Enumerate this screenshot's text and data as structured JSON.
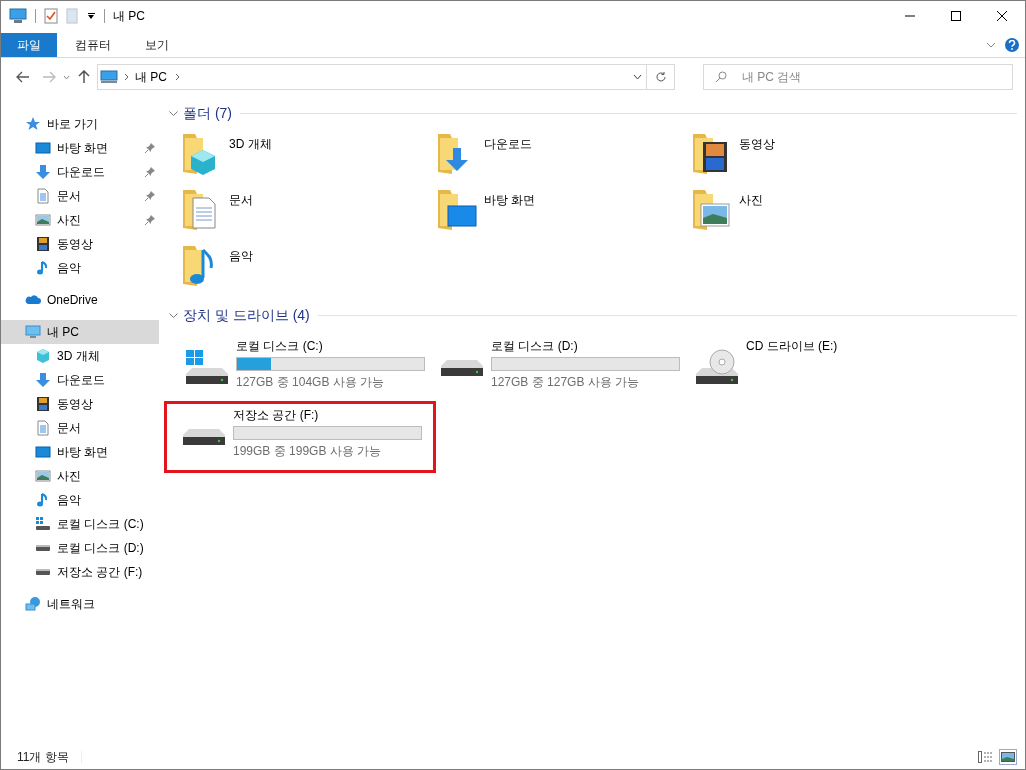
{
  "window": {
    "title": "내 PC"
  },
  "ribbon_tabs": [
    {
      "label": "파일",
      "selected": true
    },
    {
      "label": "컴퓨터",
      "selected": false
    },
    {
      "label": "보기",
      "selected": false
    }
  ],
  "address_bar": {
    "location": "내 PC"
  },
  "search": {
    "placeholder": "내 PC 검색"
  },
  "sidebar": {
    "items": [
      {
        "label": "바로 가기",
        "kind": "star",
        "selected": false,
        "children": [
          {
            "label": "바탕 화면",
            "kind": "desktop",
            "pinned": true,
            "selected": false
          },
          {
            "label": "다운로드",
            "kind": "downloads",
            "pinned": true,
            "selected": false
          },
          {
            "label": "문서",
            "kind": "documents",
            "pinned": true,
            "selected": false
          },
          {
            "label": "사진",
            "kind": "pictures",
            "pinned": true,
            "selected": false
          },
          {
            "label": "동영상",
            "kind": "videos",
            "pinned": false,
            "selected": false
          },
          {
            "label": "음악",
            "kind": "music",
            "pinned": false,
            "selected": false
          }
        ]
      },
      {
        "label": "OneDrive",
        "kind": "cloud",
        "selected": false
      },
      {
        "label": "내 PC",
        "kind": "pc",
        "selected": true,
        "children": [
          {
            "label": "3D 개체",
            "kind": "cube",
            "pinned": false,
            "selected": false
          },
          {
            "label": "다운로드",
            "kind": "downloads",
            "pinned": false,
            "selected": false
          },
          {
            "label": "동영상",
            "kind": "videos",
            "pinned": false,
            "selected": false
          },
          {
            "label": "문서",
            "kind": "documents",
            "pinned": false,
            "selected": false
          },
          {
            "label": "바탕 화면",
            "kind": "desktop",
            "pinned": false,
            "selected": false
          },
          {
            "label": "사진",
            "kind": "pictures",
            "pinned": false,
            "selected": false
          },
          {
            "label": "음악",
            "kind": "music",
            "pinned": false,
            "selected": false
          },
          {
            "label": "로컬 디스크 (C:)",
            "kind": "windrive",
            "pinned": false,
            "selected": false
          },
          {
            "label": "로컬 디스크 (D:)",
            "kind": "drive",
            "pinned": false,
            "selected": false
          },
          {
            "label": "저장소 공간 (F:)",
            "kind": "drive",
            "pinned": false,
            "selected": false
          }
        ]
      },
      {
        "label": "네트워크",
        "kind": "network",
        "selected": false
      }
    ]
  },
  "folders": {
    "heading": "폴더 (7)",
    "expanded": true,
    "items": [
      {
        "label": "3D 개체",
        "kind": "cube"
      },
      {
        "label": "다운로드",
        "kind": "downloads"
      },
      {
        "label": "동영상",
        "kind": "videos"
      },
      {
        "label": "문서",
        "kind": "documents"
      },
      {
        "label": "바탕 화면",
        "kind": "desktop"
      },
      {
        "label": "사진",
        "kind": "pictures"
      },
      {
        "label": "음악",
        "kind": "music"
      }
    ]
  },
  "drives": {
    "heading": "장치 및 드라이브 (4)",
    "expanded": true,
    "items": [
      {
        "label": "로컬 디스크 (C:)",
        "kind": "windrive",
        "level": 0.18,
        "free": "127GB 중 104GB 사용 가능",
        "highlighted": false
      },
      {
        "label": "로컬 디스크 (D:)",
        "kind": "drive",
        "level": 0.0,
        "free": "127GB 중 127GB 사용 가능",
        "highlighted": false
      },
      {
        "label": "CD 드라이브 (E:)",
        "kind": "cd",
        "highlighted": false
      },
      {
        "label": "저장소 공간 (F:)",
        "kind": "drive",
        "level": 0.0,
        "free": "199GB 중 199GB 사용 가능",
        "highlighted": true
      }
    ]
  },
  "status_bar": {
    "item_count": "11개 항목"
  }
}
